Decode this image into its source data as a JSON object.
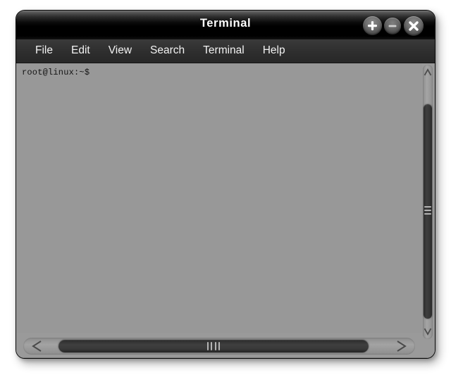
{
  "window": {
    "title": "Terminal",
    "controls": [
      {
        "name": "maximize-button",
        "icon": "plus-icon",
        "label": "+"
      },
      {
        "name": "minimize-button",
        "icon": "minus-icon",
        "label": "–"
      },
      {
        "name": "close-button",
        "icon": "close-icon",
        "label": "×"
      }
    ]
  },
  "menubar": {
    "items": [
      {
        "label": "File"
      },
      {
        "label": "Edit"
      },
      {
        "label": "View"
      },
      {
        "label": "Search"
      },
      {
        "label": "Terminal"
      },
      {
        "label": "Help"
      }
    ]
  },
  "terminal": {
    "prompt": "root@linux:~$",
    "lines": [
      "root@linux:~$"
    ],
    "background_color": "#989898",
    "foreground_color": "#141414"
  },
  "scrollbars": {
    "vertical": {
      "up_arrow_icon": "chevron-up-icon",
      "down_arrow_icon": "chevron-down-icon",
      "thumb_grip_icon": "grip-horizontal-icon"
    },
    "horizontal": {
      "left_arrow_icon": "chevron-left-icon",
      "right_arrow_icon": "chevron-right-icon",
      "thumb_grip_icon": "grip-vertical-icon"
    }
  },
  "colors": {
    "titlebar": "#000000",
    "menubar": "#2f2f2f",
    "window_frame": "#9a9a9a",
    "terminal_bg": "#989898",
    "scroll_thumb": "#383838",
    "scroll_trough": "#a3a3a3"
  }
}
